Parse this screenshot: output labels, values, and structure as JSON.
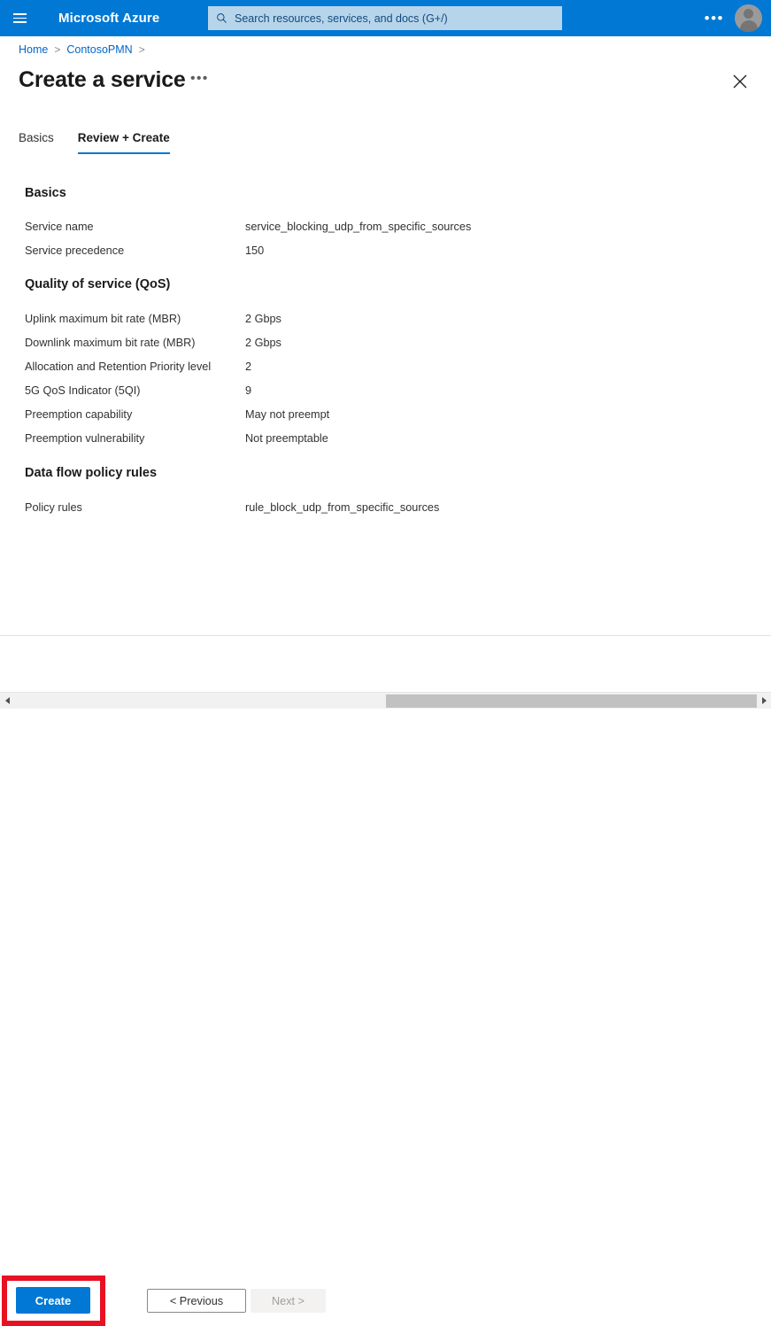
{
  "topbar": {
    "menu_icon": "hamburger-icon",
    "brand": "Microsoft Azure",
    "search_icon": "search-icon",
    "search_placeholder": "Search resources, services, and docs (G+/)",
    "search_value": "",
    "more_label": "•••",
    "avatar_icon": "user-avatar-icon",
    "background_color": "#0078d4",
    "search_background_color": "#b7d5ea"
  },
  "breadcrumb": {
    "items": [
      {
        "label": "Home"
      },
      {
        "label": "ContosoPMN"
      }
    ],
    "separator": ">"
  },
  "page": {
    "title": "Create a service",
    "more_label": "•••",
    "close_icon": "close-icon"
  },
  "tabs": [
    {
      "label": "Basics",
      "active": false
    },
    {
      "label": "Review + Create",
      "active": true
    }
  ],
  "sections": [
    {
      "heading": "Basics",
      "rows": [
        {
          "label": "Service name",
          "value": "service_blocking_udp_from_specific_sources"
        },
        {
          "label": "Service precedence",
          "value": "150"
        }
      ]
    },
    {
      "heading": "Quality of service (QoS)",
      "rows": [
        {
          "label": "Uplink maximum bit rate (MBR)",
          "value": "2 Gbps"
        },
        {
          "label": "Downlink maximum bit rate (MBR)",
          "value": "2 Gbps"
        },
        {
          "label": "Allocation and Retention Priority level",
          "value": "2"
        },
        {
          "label": "5G QoS Indicator (5QI)",
          "value": "9"
        },
        {
          "label": "Preemption capability",
          "value": "May not preempt"
        },
        {
          "label": "Preemption vulnerability",
          "value": "Not preemptable"
        }
      ]
    },
    {
      "heading": "Data flow policy rules",
      "rows": [
        {
          "label": "Policy rules",
          "value": "rule_block_udp_from_specific_sources"
        }
      ]
    }
  ],
  "footer": {
    "create_label": "Create",
    "previous_label": "< Previous",
    "next_label": "Next >",
    "next_disabled": true,
    "highlight_color": "#e81123",
    "primary_color": "#0078d4"
  },
  "scrollbar": {
    "left_arrow_icon": "caret-left-icon",
    "right_arrow_icon": "caret-right-icon"
  }
}
